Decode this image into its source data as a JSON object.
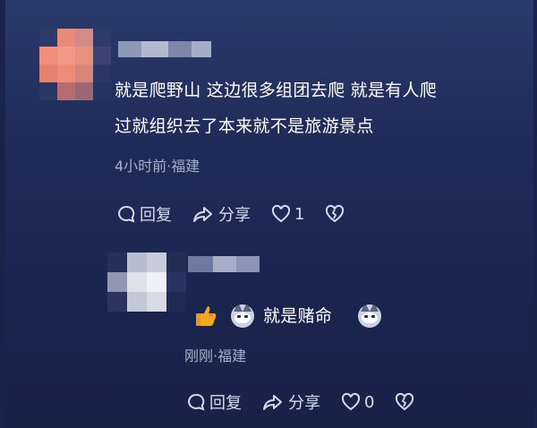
{
  "comment": {
    "text_line1": "就是爬野山 这边很多组团去爬 就是有人爬",
    "text_line2": "过就组织去了本来就不是旅游景点",
    "meta": "4小时前·福建",
    "actions": {
      "reply": "回复",
      "share": "分享",
      "likes": "1"
    }
  },
  "reply": {
    "text": "就是赌命",
    "meta": "刚刚·福建",
    "actions": {
      "reply": "回复",
      "share": "分享",
      "likes": "0"
    }
  },
  "icons": {
    "reply": "reply-bubble-icon",
    "share": "share-arrow-icon",
    "like": "heart-icon",
    "dislike": "broken-heart-icon",
    "thumb": "thumbs-up-emoji",
    "cat": "cat-emoji"
  },
  "colors": {
    "text": "#ffffff",
    "meta": "#a6b0c8",
    "action": "#d5dcec",
    "thumb": "#f5a623"
  }
}
